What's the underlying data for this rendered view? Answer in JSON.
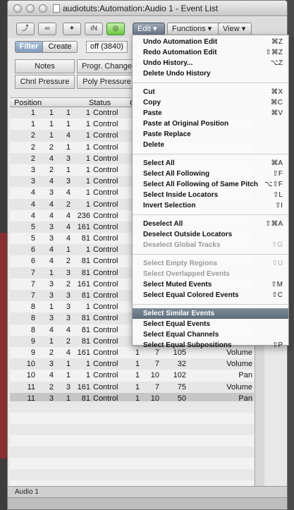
{
  "window": {
    "title": "audiotuts:Automation:Audio 1 - Event List"
  },
  "toolbar": {
    "icons": [
      "arrow-up-icon",
      "link-icon",
      "walk-icon",
      "in-icon",
      "out-icon"
    ],
    "menus": [
      "Edit",
      "Functions",
      "View"
    ]
  },
  "filter": {
    "filter_label": "Filter",
    "create_label": "Create",
    "off_label": "off (3840)"
  },
  "event_types": [
    "Notes",
    "Progr. Change",
    "Chnl Pressure",
    "Poly Pressure"
  ],
  "table": {
    "headers": [
      "Position",
      "Status",
      "C"
    ],
    "rows": [
      [
        "1",
        "1",
        "1",
        "1",
        "Control",
        "",
        "",
        "",
        ""
      ],
      [
        "1",
        "1",
        "1",
        "1",
        "Control",
        "",
        "",
        "",
        ""
      ],
      [
        "2",
        "1",
        "4",
        "1",
        "Control",
        "",
        "",
        "",
        ""
      ],
      [
        "2",
        "2",
        "1",
        "1",
        "Control",
        "",
        "",
        "",
        ""
      ],
      [
        "2",
        "4",
        "3",
        "1",
        "Control",
        "",
        "",
        "",
        ""
      ],
      [
        "3",
        "2",
        "1",
        "1",
        "Control",
        "",
        "",
        "",
        ""
      ],
      [
        "3",
        "4",
        "3",
        "1",
        "Control",
        "",
        "",
        "",
        ""
      ],
      [
        "4",
        "3",
        "4",
        "1",
        "Control",
        "",
        "",
        "",
        ""
      ],
      [
        "4",
        "4",
        "2",
        "1",
        "Control",
        "",
        "",
        "",
        ""
      ],
      [
        "4",
        "4",
        "4",
        "236",
        "Control",
        "",
        "",
        "",
        ""
      ],
      [
        "5",
        "3",
        "4",
        "161",
        "Control",
        "",
        "",
        "",
        ""
      ],
      [
        "5",
        "3",
        "4",
        "81",
        "Control",
        "",
        "",
        "",
        ""
      ],
      [
        "6",
        "4",
        "1",
        "1",
        "Control",
        "",
        "",
        "",
        ""
      ],
      [
        "6",
        "4",
        "2",
        "81",
        "Control",
        "",
        "",
        "",
        ""
      ],
      [
        "7",
        "1",
        "3",
        "81",
        "Control",
        "",
        "",
        "",
        ""
      ],
      [
        "7",
        "3",
        "2",
        "161",
        "Control",
        "",
        "",
        "",
        ""
      ],
      [
        "7",
        "3",
        "3",
        "81",
        "Control",
        "",
        "",
        "",
        ""
      ],
      [
        "8",
        "1",
        "3",
        "1",
        "Control",
        "",
        "",
        "",
        ""
      ],
      [
        "8",
        "3",
        "3",
        "81",
        "Control",
        "",
        "",
        "",
        ""
      ],
      [
        "8",
        "4",
        "4",
        "81",
        "Control",
        "",
        "",
        "",
        ""
      ],
      [
        "9",
        "1",
        "2",
        "81",
        "Control",
        "",
        "",
        "",
        ""
      ],
      [
        "9",
        "2",
        "4",
        "161",
        "Control",
        "1",
        "7",
        "105",
        "Volume"
      ],
      [
        "10",
        "3",
        "1",
        "1",
        "Control",
        "1",
        "7",
        "32",
        "Volume"
      ],
      [
        "10",
        "4",
        "1",
        "1",
        "Control",
        "1",
        "10",
        "102",
        "Pan"
      ],
      [
        "11",
        "2",
        "3",
        "161",
        "Control",
        "1",
        "7",
        "75",
        "Volume"
      ],
      [
        "11",
        "3",
        "1",
        "81",
        "Control",
        "1",
        "10",
        "50",
        "Pan"
      ]
    ]
  },
  "status": {
    "track_name": "Audio 1"
  },
  "edit_menu": {
    "groups": [
      [
        {
          "label": "Undo Automation Edit",
          "shortcut": "⌘Z",
          "disabled": false,
          "highlighted": false
        },
        {
          "label": "Redo Automation Edit",
          "shortcut": "⇧⌘Z",
          "disabled": false,
          "highlighted": false
        },
        {
          "label": "Undo History...",
          "shortcut": "⌥Z",
          "disabled": false,
          "highlighted": false
        },
        {
          "label": "Delete Undo History",
          "shortcut": "",
          "disabled": false,
          "highlighted": false
        }
      ],
      [
        {
          "label": "Cut",
          "shortcut": "⌘X",
          "disabled": false,
          "highlighted": false
        },
        {
          "label": "Copy",
          "shortcut": "⌘C",
          "disabled": false,
          "highlighted": false
        },
        {
          "label": "Paste",
          "shortcut": "⌘V",
          "disabled": false,
          "highlighted": false
        },
        {
          "label": "Paste at Original Position",
          "shortcut": "",
          "disabled": false,
          "highlighted": false
        },
        {
          "label": "Paste Replace",
          "shortcut": "",
          "disabled": false,
          "highlighted": false
        },
        {
          "label": "Delete",
          "shortcut": "",
          "disabled": false,
          "highlighted": false
        }
      ],
      [
        {
          "label": "Select All",
          "shortcut": "⌘A",
          "disabled": false,
          "highlighted": false
        },
        {
          "label": "Select All Following",
          "shortcut": "⇧F",
          "disabled": false,
          "highlighted": false
        },
        {
          "label": "Select All Following of Same Pitch",
          "shortcut": "⌥⇧F",
          "disabled": false,
          "highlighted": false
        },
        {
          "label": "Select Inside Locators",
          "shortcut": "⇧L",
          "disabled": false,
          "highlighted": false
        },
        {
          "label": "Invert Selection",
          "shortcut": "⇧I",
          "disabled": false,
          "highlighted": false
        }
      ],
      [
        {
          "label": "Deselect All",
          "shortcut": "⇧⌘A",
          "disabled": false,
          "highlighted": false
        },
        {
          "label": "Deselect Outside Locators",
          "shortcut": "",
          "disabled": false,
          "highlighted": false
        },
        {
          "label": "Deselect Global Tracks",
          "shortcut": "⇧G",
          "disabled": true,
          "highlighted": false
        }
      ],
      [
        {
          "label": "Select Empty Regions",
          "shortcut": "⇧U",
          "disabled": true,
          "highlighted": false
        },
        {
          "label": "Select Overlapped Events",
          "shortcut": "",
          "disabled": true,
          "highlighted": false
        },
        {
          "label": "Select Muted Events",
          "shortcut": "⇧M",
          "disabled": false,
          "highlighted": false
        },
        {
          "label": "Select Equal Colored Events",
          "shortcut": "⇧C",
          "disabled": false,
          "highlighted": false
        }
      ],
      [
        {
          "label": "Select Similar Events",
          "shortcut": "",
          "disabled": false,
          "highlighted": true
        },
        {
          "label": "Select Equal Events",
          "shortcut": "",
          "disabled": false,
          "highlighted": false
        },
        {
          "label": "Select Equal Channels",
          "shortcut": "",
          "disabled": false,
          "highlighted": false
        },
        {
          "label": "Select Equal Subpositions",
          "shortcut": "⇧P",
          "disabled": false,
          "highlighted": false
        }
      ]
    ]
  }
}
